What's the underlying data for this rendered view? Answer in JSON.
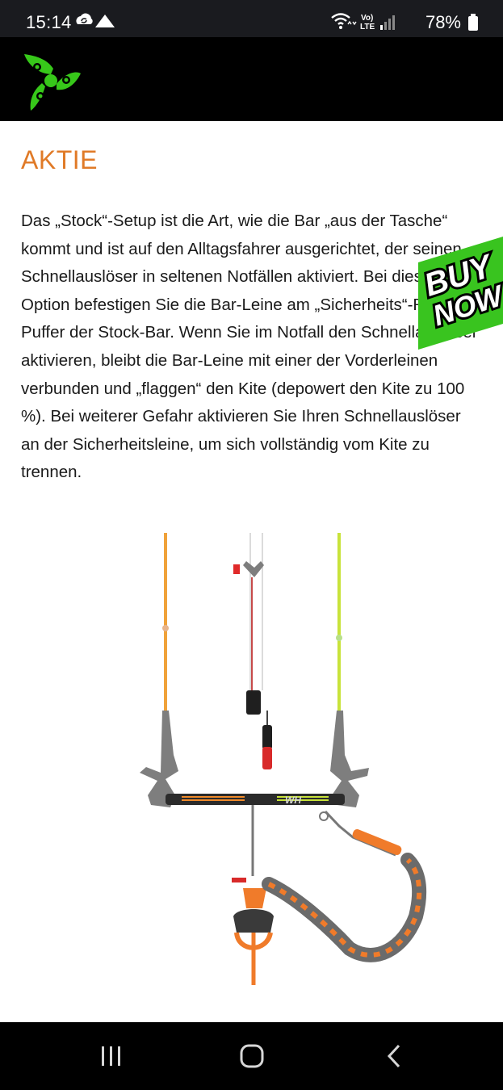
{
  "status_bar": {
    "time": "15:14",
    "battery": "78%",
    "network_label": "Vo) LTE",
    "icons": [
      "sync-icon",
      "warning-triangle-icon",
      "wifi-icon",
      "volte-icon",
      "signal-icon",
      "battery-icon"
    ]
  },
  "header": {
    "logo_icon": "triple-swirl-logo-icon",
    "background": "#000000",
    "logo_color": "#37c81a"
  },
  "article": {
    "title": "AKTIE",
    "title_color": "#e07a27",
    "paragraph": "Das „Stock“-Setup ist die Art, wie die Bar „aus der Tasche“ kommt und ist auf den Alltagsfahrer ausgerichtet, der seinen Schnellauslöser in seltenen Notfällen aktiviert. Bei dieser Option befestigen Sie die Bar-Leine am „Sicherheits“-Ring am Puffer der Stock-Bar. Wenn Sie im Notfall den Schnellauslöser aktivieren, bleibt die Bar-Leine mit einer der Vorderleinen verbunden und „flaggen“ den Kite (depowert den Kite zu 100 %). Bei weiterer Gefahr aktivieren Sie Ihren Schnellauslöser an der Sicherheitsleine, um sich vollständig vom Kite zu trennen."
  },
  "buy_now_badge": {
    "line1": "BUY",
    "line2": "NOW",
    "background": "#39c41f"
  },
  "product": {
    "bar_logo_text": "WH"
  },
  "nav_bar": {
    "buttons": [
      "recents-icon",
      "home-icon",
      "back-icon"
    ]
  }
}
